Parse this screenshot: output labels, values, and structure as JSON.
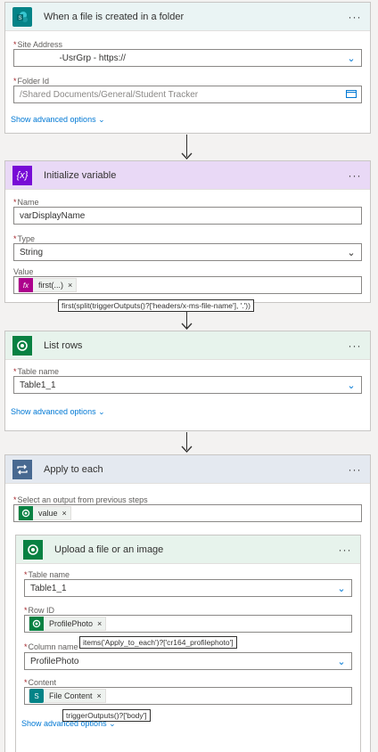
{
  "card1": {
    "title": "When a file is created in a folder",
    "icon": "sharepoint-icon",
    "more": "···",
    "site_label": "Site Address",
    "site_value": "                -UsrGrp - https://",
    "folder_label": "Folder Id",
    "folder_value": "/Shared Documents/General/Student Tracker",
    "advanced": "Show advanced options"
  },
  "card2": {
    "title": "Initialize variable",
    "icon_glyph": "{x}",
    "more": "···",
    "name_label": "Name",
    "name_value": "varDisplayName",
    "type_label": "Type",
    "type_value": "String",
    "value_label": "Value",
    "token_icon": "fx",
    "token_label": "first(...)",
    "tooltip": "first(split(triggerOutputs()?['headers/x-ms-file-name'], '.'))"
  },
  "card3": {
    "title": "List rows",
    "more": "···",
    "table_label": "Table name",
    "table_value": "Table1_1",
    "advanced": "Show advanced options"
  },
  "card4": {
    "title": "Apply to each",
    "more": "···",
    "select_label": "Select an output from previous steps",
    "select_token": "value"
  },
  "card5": {
    "title": "Upload a file or an image",
    "more": "···",
    "table_label": "Table name",
    "table_value": "Table1_1",
    "row_label": "Row ID",
    "row_token": "ProfilePhoto",
    "row_tooltip": "items('Apply_to_each')?['cr164_profilephoto']",
    "column_label": "Column name",
    "column_value": "ProfilePhoto",
    "content_label": "Content",
    "content_token": "File Content",
    "content_tooltip": "triggerOutputs()?['body']",
    "advanced": "Show advanced options"
  },
  "colors": {
    "sharepoint": "#038387",
    "variable": "#770bd6",
    "dataverse": "#088142",
    "loop": "#486991",
    "link": "#0078d4"
  }
}
